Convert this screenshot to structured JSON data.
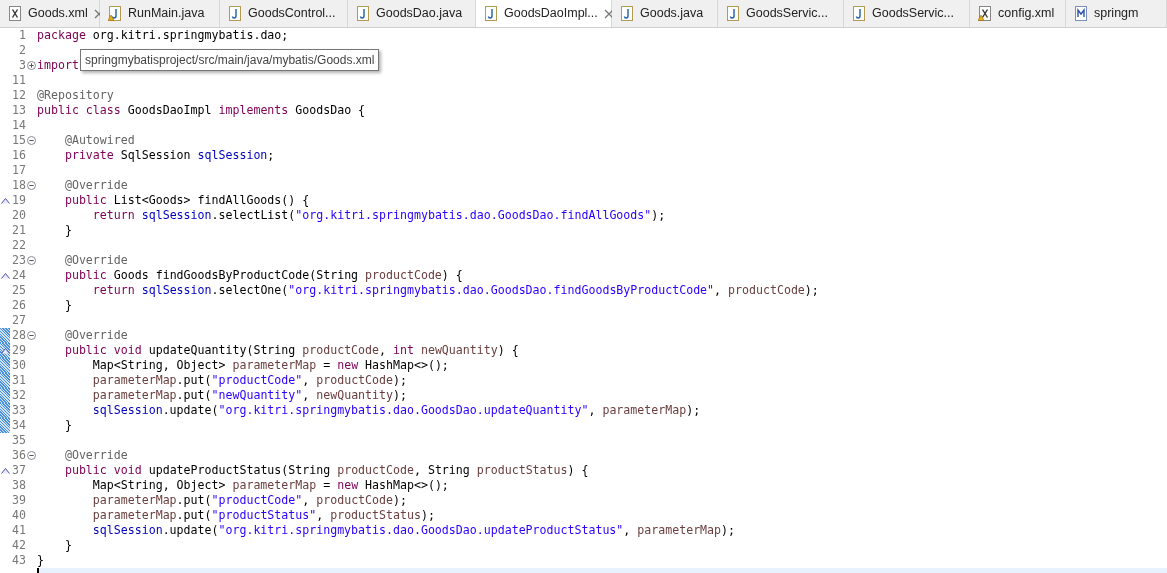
{
  "tabs": [
    {
      "label": "Goods.xml",
      "kind": "xml",
      "warning": false,
      "closable": true,
      "selected": false
    },
    {
      "label": "RunMain.java",
      "kind": "java",
      "warning": true,
      "closable": false,
      "selected": false
    },
    {
      "label": "GoodsControl...",
      "kind": "java",
      "warning": false,
      "closable": false,
      "selected": false
    },
    {
      "label": "GoodsDao.java",
      "kind": "java",
      "warning": false,
      "closable": false,
      "selected": false
    },
    {
      "label": "GoodsDaoImpl...",
      "kind": "java",
      "warning": false,
      "closable": true,
      "selected": true
    },
    {
      "label": "Goods.java",
      "kind": "java",
      "warning": false,
      "closable": false,
      "selected": false
    },
    {
      "label": "GoodsServic...",
      "kind": "java",
      "warning": false,
      "closable": false,
      "selected": false
    },
    {
      "label": "GoodsServic...",
      "kind": "java",
      "warning": false,
      "closable": false,
      "selected": false
    },
    {
      "label": "config.xml",
      "kind": "xml",
      "warning": true,
      "closable": false,
      "selected": false
    },
    {
      "label": "springm",
      "kind": "maven",
      "warning": false,
      "closable": false,
      "selected": false
    }
  ],
  "tooltip": "springmybatisproject/src/main/java/mybatis/Goods.xml",
  "lines": [
    {
      "n": "1",
      "tokens": [
        {
          "kind": "kw",
          "s": "package"
        },
        {
          "kind": "p",
          "s": " org.kitri.springmybatis.dao;"
        }
      ]
    },
    {
      "n": "2"
    },
    {
      "n": "3",
      "expanded": false,
      "tokens": [
        {
          "kind": "kw",
          "s": "import"
        }
      ]
    },
    {
      "n": "11"
    },
    {
      "n": "12",
      "tokens": [
        {
          "kind": "an",
          "s": "@Repository"
        }
      ]
    },
    {
      "n": "13",
      "tokens": [
        {
          "kind": "kw",
          "s": "public"
        },
        {
          "kind": "kw",
          "s": " class"
        },
        {
          "kind": "p",
          "s": " GoodsDaoImpl"
        },
        {
          "kind": "kw",
          "s": " implements"
        },
        {
          "kind": "p",
          "s": " GoodsDao {"
        }
      ]
    },
    {
      "n": "14"
    },
    {
      "n": "15",
      "expanded": true,
      "tokens": [
        {
          "kind": "an",
          "s": "    @Autowired"
        }
      ]
    },
    {
      "n": "16",
      "tokens": [
        {
          "kind": "kw",
          "s": "    private"
        },
        {
          "kind": "p",
          "s": " SqlSession"
        },
        {
          "kind": "fd",
          "s": " sqlSession"
        },
        {
          "kind": "p",
          "s": ";"
        }
      ]
    },
    {
      "n": "17"
    },
    {
      "n": "18",
      "expanded": true,
      "tokens": [
        {
          "kind": "an",
          "s": "    @Override"
        }
      ]
    },
    {
      "n": "19",
      "override": true,
      "tokens": [
        {
          "kind": "kw",
          "s": "    public"
        },
        {
          "kind": "p",
          "s": " List<Goods> findAllGoods() {"
        }
      ]
    },
    {
      "n": "20",
      "tokens": [
        {
          "kind": "kw",
          "s": "        return"
        },
        {
          "kind": "fd",
          "s": " sqlSession"
        },
        {
          "kind": "p",
          "s": ".selectList("
        },
        {
          "kind": "st",
          "s": "\"org.kitri.springmybatis.dao.GoodsDao.findAllGoods\""
        },
        {
          "kind": "p",
          "s": ");"
        }
      ]
    },
    {
      "n": "21",
      "tokens": [
        {
          "kind": "p",
          "s": "    }"
        }
      ]
    },
    {
      "n": "22"
    },
    {
      "n": "23",
      "expanded": true,
      "tokens": [
        {
          "kind": "an",
          "s": "    @Override"
        }
      ]
    },
    {
      "n": "24",
      "override": true,
      "tokens": [
        {
          "kind": "kw",
          "s": "    public"
        },
        {
          "kind": "p",
          "s": " Goods findGoodsByProductCode(String"
        },
        {
          "kind": "va",
          "s": " productCode"
        },
        {
          "kind": "p",
          "s": ") {"
        }
      ]
    },
    {
      "n": "25",
      "tokens": [
        {
          "kind": "kw",
          "s": "        return"
        },
        {
          "kind": "fd",
          "s": " sqlSession"
        },
        {
          "kind": "p",
          "s": ".selectOne("
        },
        {
          "kind": "st",
          "s": "\"org.kitri.springmybatis.dao.GoodsDao.findGoodsByProductCode\""
        },
        {
          "kind": "p",
          "s": ","
        },
        {
          "kind": "va",
          "s": " productCode"
        },
        {
          "kind": "p",
          "s": ");"
        }
      ]
    },
    {
      "n": "26",
      "tokens": [
        {
          "kind": "p",
          "s": "    }"
        }
      ]
    },
    {
      "n": "27"
    },
    {
      "n": "28",
      "expanded": true,
      "changed": true,
      "tokens": [
        {
          "kind": "an",
          "s": "    @Override"
        }
      ]
    },
    {
      "n": "29",
      "override": true,
      "changed": true,
      "tokens": [
        {
          "kind": "kw",
          "s": "    public"
        },
        {
          "kind": "kw",
          "s": " void"
        },
        {
          "kind": "p",
          "s": " updateQuantity(String"
        },
        {
          "kind": "va",
          "s": " productCode"
        },
        {
          "kind": "p",
          "s": ","
        },
        {
          "kind": "kw",
          "s": " int"
        },
        {
          "kind": "va",
          "s": " newQuantity"
        },
        {
          "kind": "p",
          "s": ") {"
        }
      ]
    },
    {
      "n": "30",
      "changed": true,
      "tokens": [
        {
          "kind": "p",
          "s": "        Map<String, Object>"
        },
        {
          "kind": "va",
          "s": " parameterMap"
        },
        {
          "kind": "p",
          "s": " ="
        },
        {
          "kind": "kw",
          "s": " new"
        },
        {
          "kind": "p",
          "s": " HashMap<>();"
        }
      ]
    },
    {
      "n": "31",
      "changed": true,
      "tokens": [
        {
          "kind": "va",
          "s": "        parameterMap"
        },
        {
          "kind": "p",
          "s": ".put("
        },
        {
          "kind": "st",
          "s": "\"productCode\""
        },
        {
          "kind": "p",
          "s": ","
        },
        {
          "kind": "va",
          "s": " productCode"
        },
        {
          "kind": "p",
          "s": ");"
        }
      ]
    },
    {
      "n": "32",
      "changed": true,
      "tokens": [
        {
          "kind": "va",
          "s": "        parameterMap"
        },
        {
          "kind": "p",
          "s": ".put("
        },
        {
          "kind": "st",
          "s": "\"newQuantity\""
        },
        {
          "kind": "p",
          "s": ","
        },
        {
          "kind": "va",
          "s": " newQuantity"
        },
        {
          "kind": "p",
          "s": ");"
        }
      ]
    },
    {
      "n": "33",
      "changed": true,
      "tokens": [
        {
          "kind": "fd",
          "s": "        sqlSession"
        },
        {
          "kind": "p",
          "s": ".update("
        },
        {
          "kind": "st",
          "s": "\"org.kitri.springmybatis.dao.GoodsDao.updateQuantity\""
        },
        {
          "kind": "p",
          "s": ","
        },
        {
          "kind": "va",
          "s": " parameterMap"
        },
        {
          "kind": "p",
          "s": ");"
        }
      ]
    },
    {
      "n": "34",
      "changed": true,
      "tokens": [
        {
          "kind": "p",
          "s": "    }"
        }
      ]
    },
    {
      "n": "35"
    },
    {
      "n": "36",
      "expanded": true,
      "tokens": [
        {
          "kind": "an",
          "s": "    @Override"
        }
      ]
    },
    {
      "n": "37",
      "override": true,
      "tokens": [
        {
          "kind": "kw",
          "s": "    public"
        },
        {
          "kind": "kw",
          "s": " void"
        },
        {
          "kind": "p",
          "s": " updateProductStatus(String"
        },
        {
          "kind": "va",
          "s": " productCode"
        },
        {
          "kind": "p",
          "s": ", String"
        },
        {
          "kind": "va",
          "s": " productStatus"
        },
        {
          "kind": "p",
          "s": ") {"
        }
      ]
    },
    {
      "n": "38",
      "tokens": [
        {
          "kind": "p",
          "s": "        Map<String, Object>"
        },
        {
          "kind": "va",
          "s": " parameterMap"
        },
        {
          "kind": "p",
          "s": " ="
        },
        {
          "kind": "kw",
          "s": " new"
        },
        {
          "kind": "p",
          "s": " HashMap<>();"
        }
      ]
    },
    {
      "n": "39",
      "tokens": [
        {
          "kind": "va",
          "s": "        parameterMap"
        },
        {
          "kind": "p",
          "s": ".put("
        },
        {
          "kind": "st",
          "s": "\"productCode\""
        },
        {
          "kind": "p",
          "s": ","
        },
        {
          "kind": "va",
          "s": " productCode"
        },
        {
          "kind": "p",
          "s": ");"
        }
      ]
    },
    {
      "n": "40",
      "tokens": [
        {
          "kind": "va",
          "s": "        parameterMap"
        },
        {
          "kind": "p",
          "s": ".put("
        },
        {
          "kind": "st",
          "s": "\"productStatus\""
        },
        {
          "kind": "p",
          "s": ","
        },
        {
          "kind": "va",
          "s": " productStatus"
        },
        {
          "kind": "p",
          "s": ");"
        }
      ]
    },
    {
      "n": "41",
      "tokens": [
        {
          "kind": "fd",
          "s": "        sqlSession"
        },
        {
          "kind": "p",
          "s": ".update("
        },
        {
          "kind": "st",
          "s": "\"org.kitri.springmybatis.dao.GoodsDao.updateProductStatus\""
        },
        {
          "kind": "p",
          "s": ","
        },
        {
          "kind": "va",
          "s": " parameterMap"
        },
        {
          "kind": "p",
          "s": ");"
        }
      ]
    },
    {
      "n": "42",
      "tokens": [
        {
          "kind": "p",
          "s": "    }"
        }
      ]
    },
    {
      "n": "43",
      "tokens": [
        {
          "kind": "p",
          "s": "}"
        }
      ]
    }
  ]
}
